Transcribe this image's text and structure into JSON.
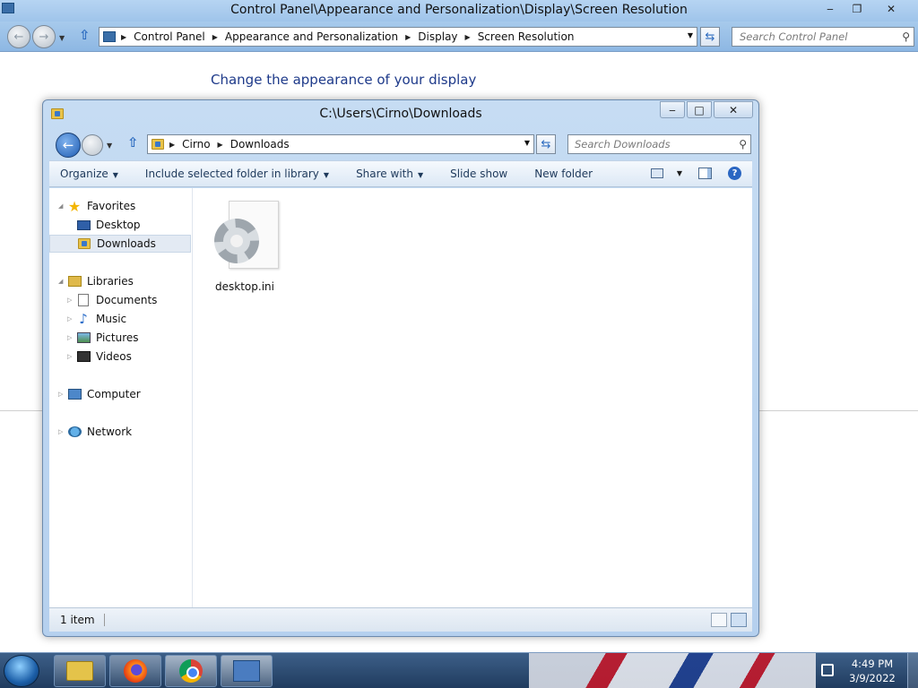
{
  "control_panel": {
    "title": "Control Panel\\Appearance and Personalization\\Display\\Screen Resolution",
    "breadcrumbs": [
      "Control Panel",
      "Appearance and Personalization",
      "Display",
      "Screen Resolution"
    ],
    "search_placeholder": "Search Control Panel",
    "heading": "Change the appearance of your display"
  },
  "explorer": {
    "title": "C:\\Users\\Cirno\\Downloads",
    "breadcrumbs": [
      "Cirno",
      "Downloads"
    ],
    "search_placeholder": "Search Downloads",
    "toolbar": {
      "organize": "Organize",
      "include_library": "Include selected folder in library",
      "share_with": "Share with",
      "slide_show": "Slide show",
      "new_folder": "New folder"
    },
    "nav": {
      "favorites": "Favorites",
      "desktop": "Desktop",
      "downloads": "Downloads",
      "libraries": "Libraries",
      "documents": "Documents",
      "music": "Music",
      "pictures": "Pictures",
      "videos": "Videos",
      "computer": "Computer",
      "network": "Network"
    },
    "files": [
      {
        "name": "desktop.ini",
        "icon": "settings-file-icon"
      }
    ],
    "status": "1 item"
  },
  "taskbar": {
    "apps": [
      "file-explorer",
      "firefox",
      "chrome",
      "control-panel"
    ],
    "time": "4:49 PM",
    "date": "3/9/2022"
  },
  "colors": {
    "accent": "#1e3a8a",
    "titlebar": "#b6d4f2",
    "taskbar": "#203c5f"
  }
}
